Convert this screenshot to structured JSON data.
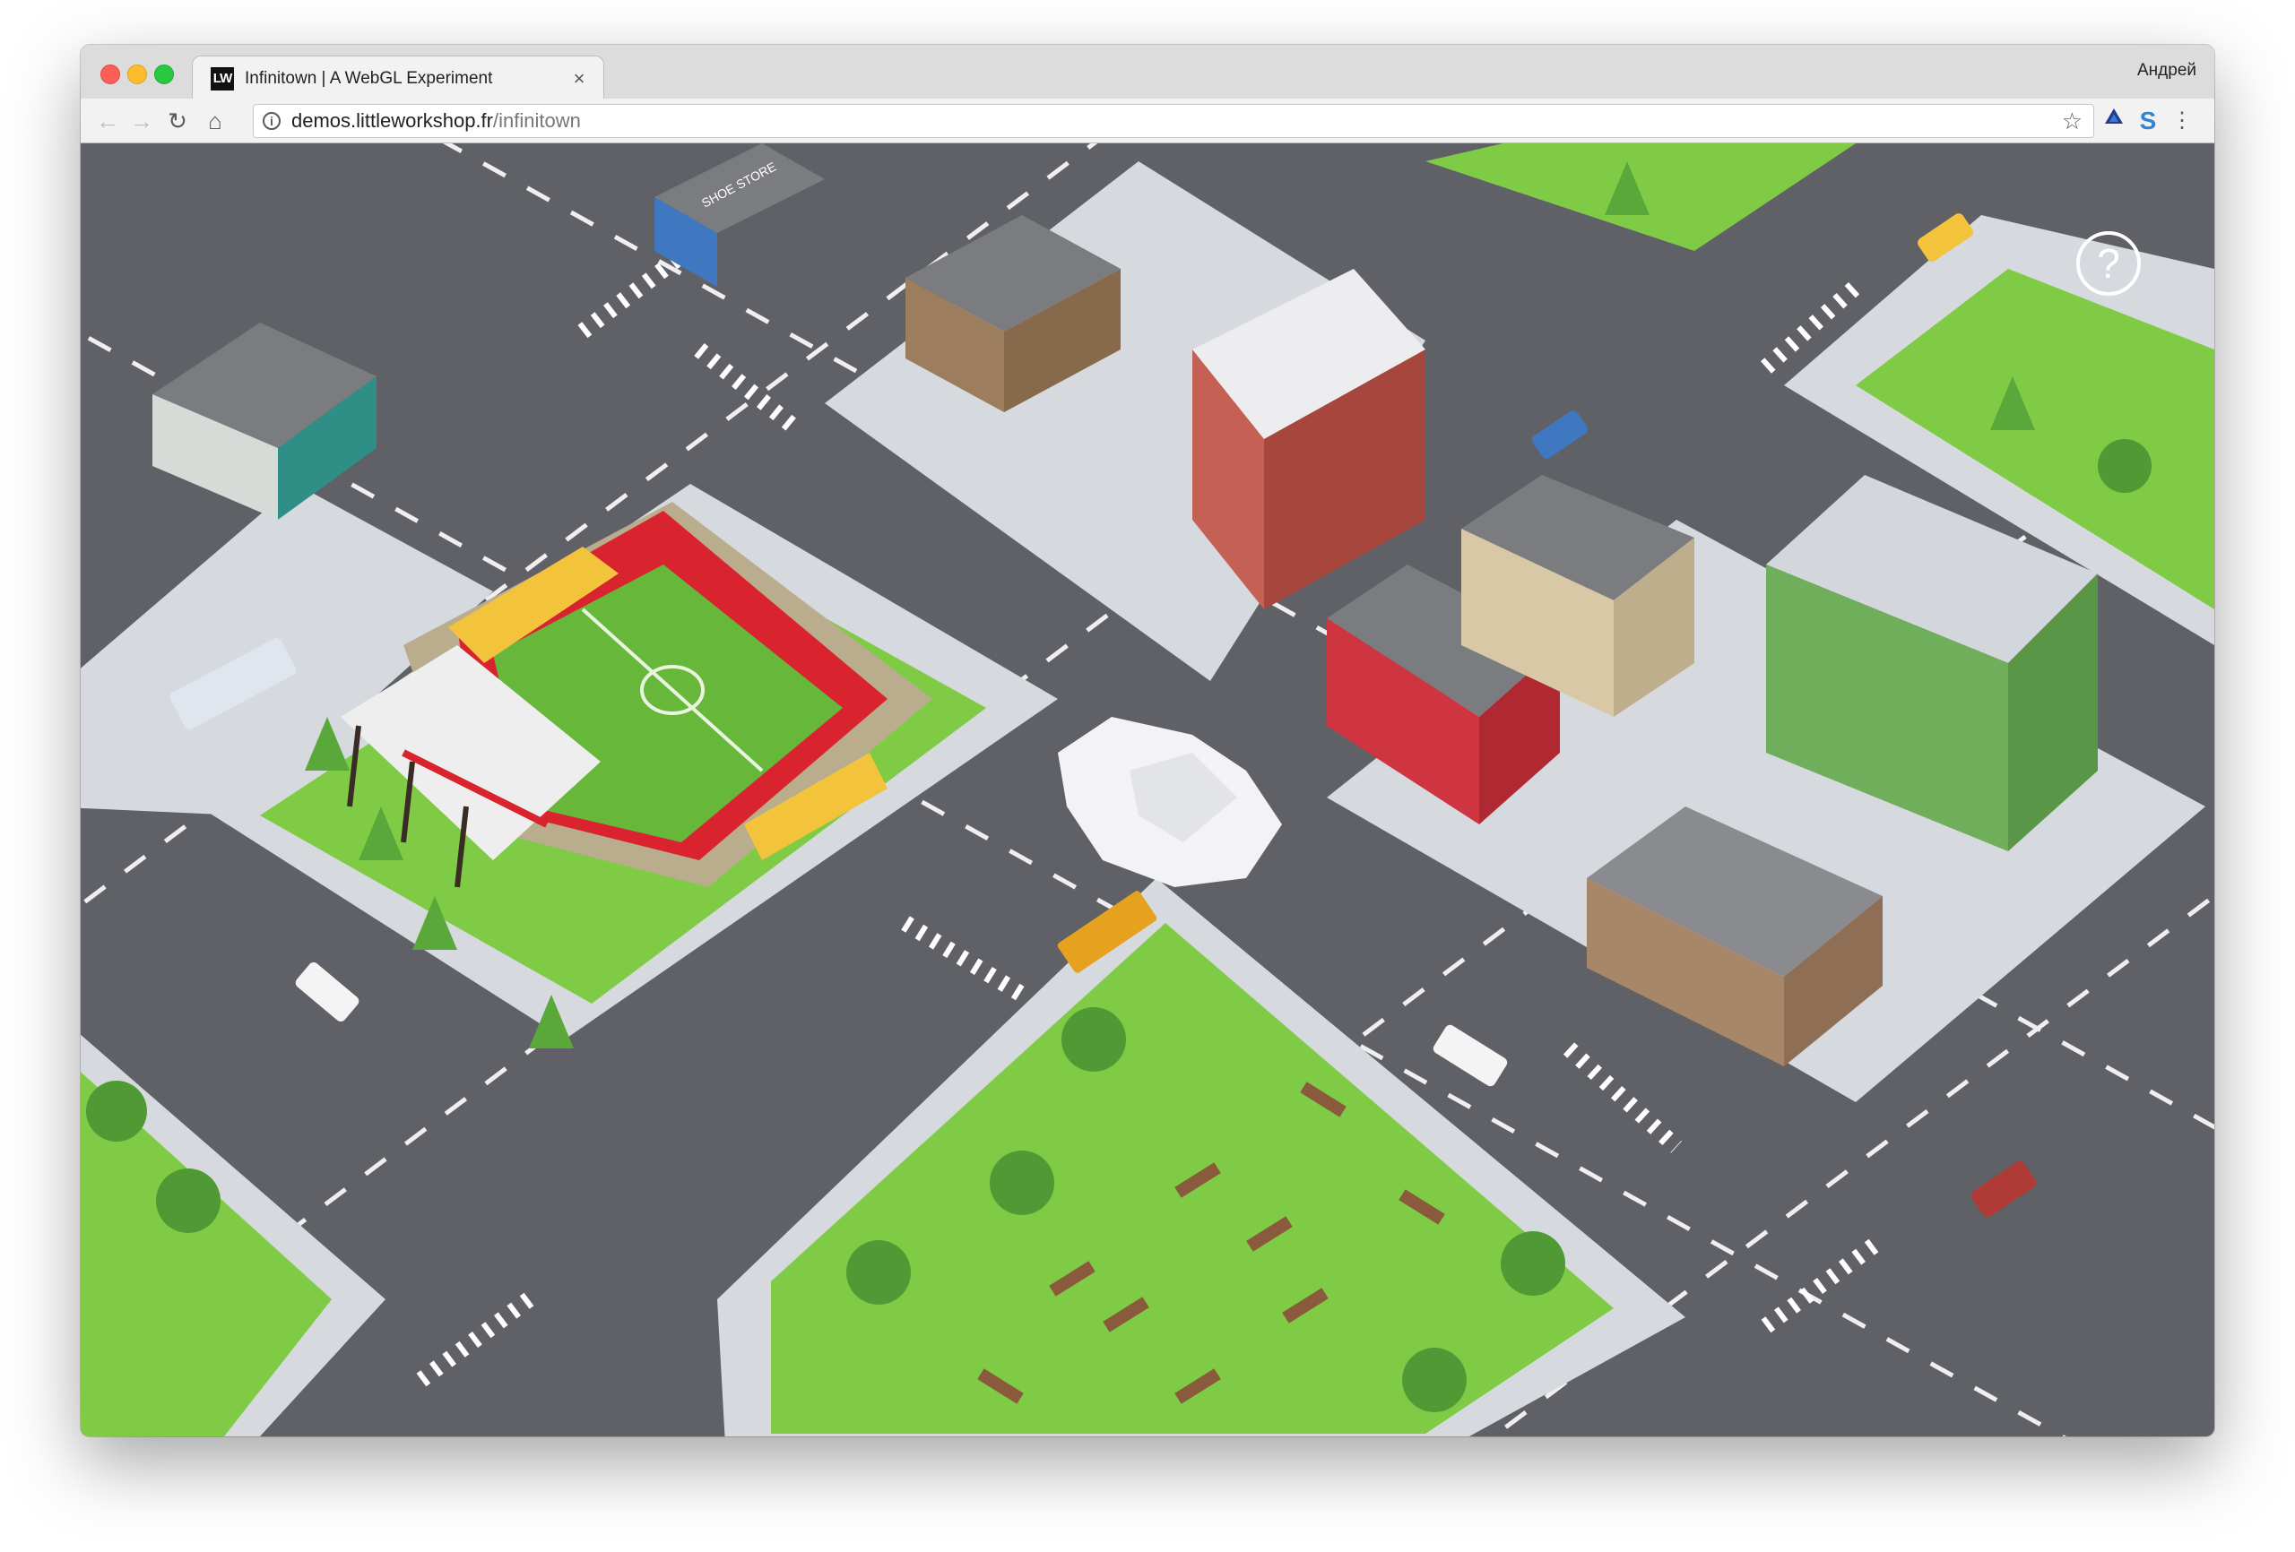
{
  "window": {
    "tab": {
      "favicon_text": "LW",
      "title": "Infinitown | A WebGL Experiment"
    },
    "profile_name": "Андрей"
  },
  "toolbar": {
    "url_host": "demos.littleworkshop.fr",
    "url_path": "/infinitown"
  },
  "scene": {
    "shop_sign": "SHOE STORE",
    "colors": {
      "asphalt": "#5f6166",
      "sidewalk": "#d6d9de",
      "grass": "#7fcb45",
      "pitch": "#67b83a",
      "stand_red": "#d9232f",
      "stand_yellow": "#f3c33c",
      "truck": "#e6a21f"
    }
  }
}
